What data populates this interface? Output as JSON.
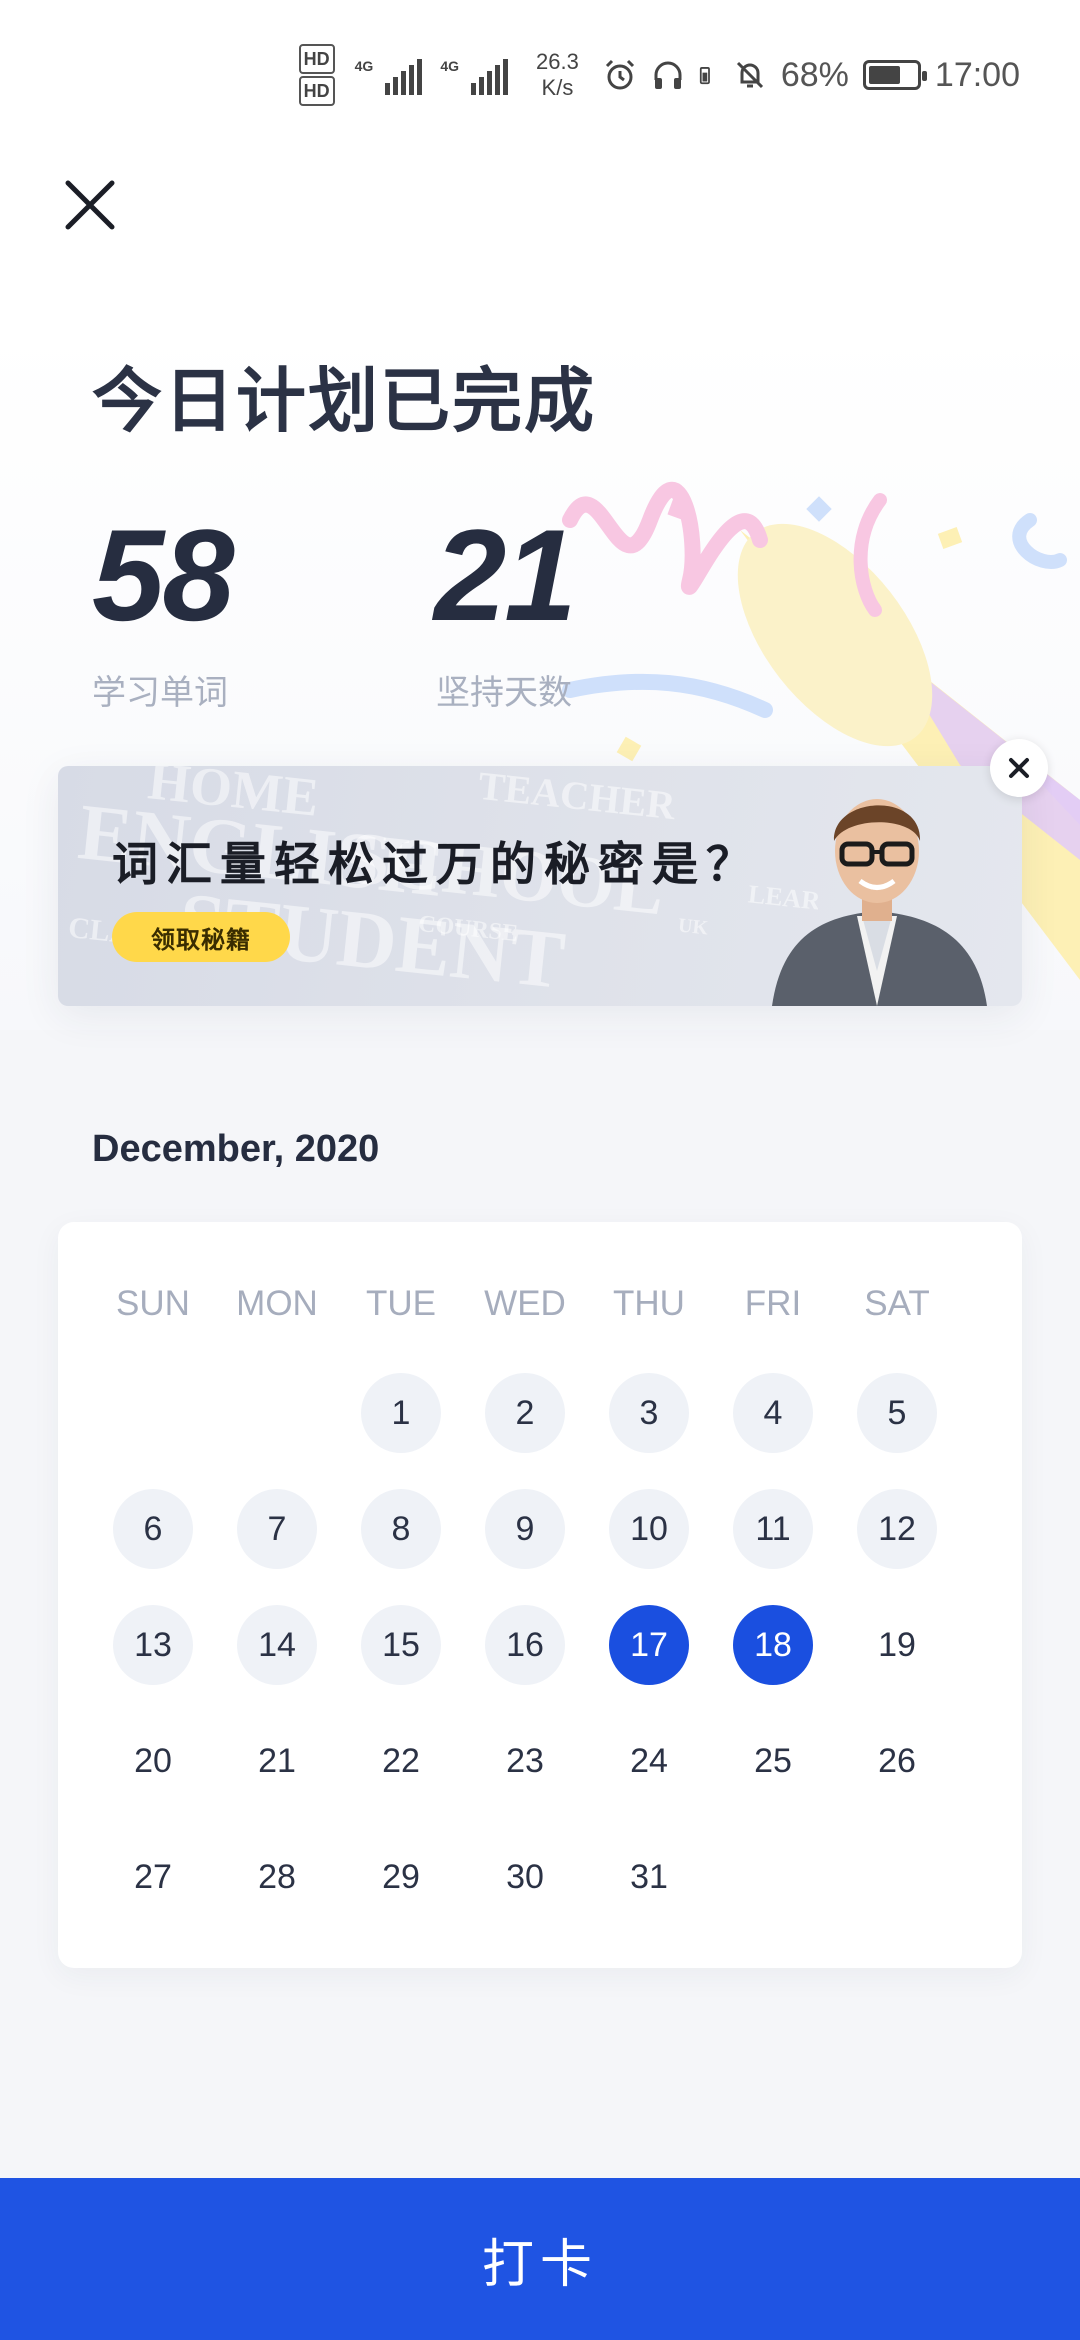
{
  "status_bar": {
    "hd1": "HD",
    "hd2": "HD",
    "net1": "4G",
    "net2": "4G",
    "speed_value": "26.3",
    "speed_unit": "K/s",
    "battery": "68%",
    "battery_level": 0.68,
    "time": "17:00"
  },
  "page": {
    "title": "今日计划已完成",
    "stats": [
      {
        "value": "58",
        "label": "学习单词"
      },
      {
        "value": "21",
        "label": "坚持天数"
      }
    ]
  },
  "banner": {
    "headline": "词汇量轻松过万的秘密是？",
    "cta": "领取秘籍",
    "bg_words": [
      "HOME",
      "TEACHER",
      "ENGLISH",
      "SCHOOL",
      "STUDENT",
      "COURSE",
      "UK",
      "CLASS",
      "LEARN"
    ]
  },
  "calendar": {
    "month_label": "December, 2020",
    "weekdays": [
      "SUN",
      "MON",
      "TUE",
      "WED",
      "THU",
      "FRI",
      "SAT"
    ],
    "first_weekday": 2,
    "days_in_month": 31,
    "past_until": 16,
    "checked_days": [
      17,
      18
    ]
  },
  "actions": {
    "checkin_label": "打卡"
  },
  "colors": {
    "accent": "#1f54e3",
    "checked": "#1a4fe0",
    "past_bg": "#eff2f7",
    "title": "#2b3245",
    "muted": "#a9b0c0",
    "pill": "#ffd84a"
  }
}
